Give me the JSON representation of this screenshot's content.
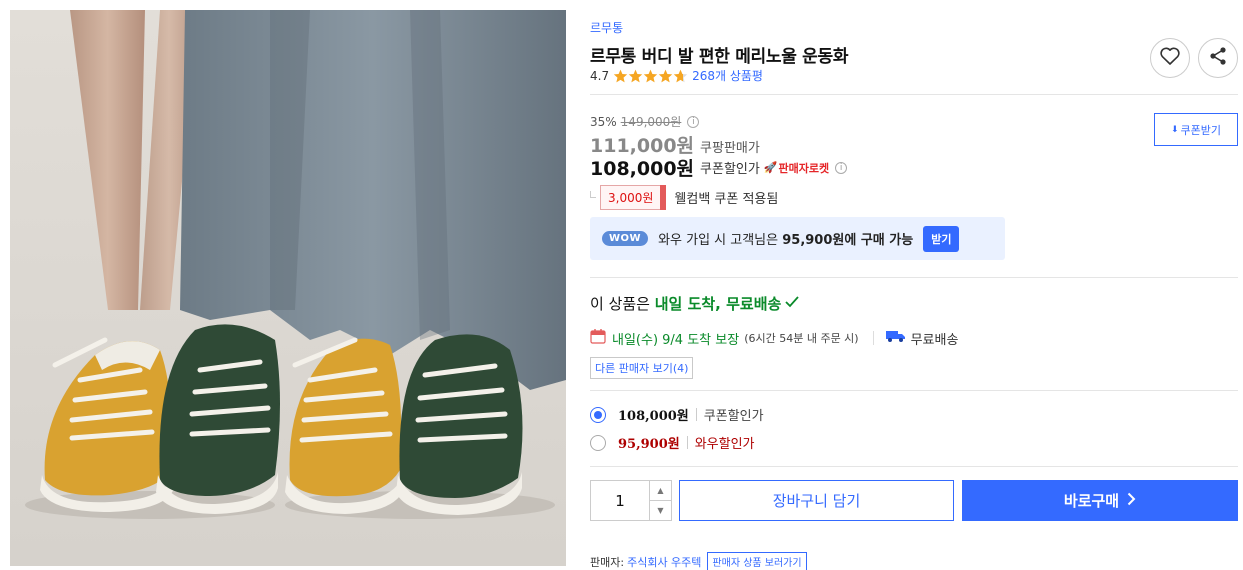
{
  "product": {
    "brand": "르무통",
    "title": "르무통 버디 발 편한 메리노울 운동화",
    "rating": "4.7",
    "stars_value": 4.7,
    "review_count": "268개 상품평"
  },
  "actions": {
    "wishlist_icon": "heart-icon",
    "share_icon": "share-icon",
    "coupon_download": "쿠폰받기"
  },
  "price": {
    "discount_rate": "35%",
    "original": "149,000원",
    "sale": "111,000원",
    "sale_label": "쿠팡판매가",
    "coupon_price": "108,000원",
    "coupon_label": "쿠폰할인가",
    "rocket_label": "판매자로켓",
    "welcome_amount": "3,000원",
    "welcome_text": "웰컴백 쿠폰 적용됨"
  },
  "wow": {
    "badge": "WOW",
    "text_before": "와우 가입 시 고객님은 ",
    "text_bold": "95,900원에 구매 가능",
    "button": "받기"
  },
  "delivery": {
    "title_prefix": "이 상품은 ",
    "title_highlight": "내일 도착, 무료배송",
    "arrival": "내일(수) 9/4 도착 보장",
    "arrival_note": "(6시간 54분 내 주문 시)",
    "free_shipping": "무료배송",
    "other_sellers": "다른 판매자 보기(4)"
  },
  "options": [
    {
      "price": "108,000원",
      "label": "쿠폰할인가",
      "selected": true
    },
    {
      "price": "95,900원",
      "label": "와우할인가",
      "selected": false
    }
  ],
  "purchase": {
    "quantity": "1",
    "add_to_cart": "장바구니 담기",
    "buy_now": "바로구매"
  },
  "seller": {
    "label": "판매자:",
    "name": "주식회사 우주텍",
    "link": "판매자 상품 보러가기"
  },
  "colors": {
    "accent": "#346aff",
    "green": "#0a8a2a",
    "red": "#ae0000",
    "star": "#f5a623"
  }
}
